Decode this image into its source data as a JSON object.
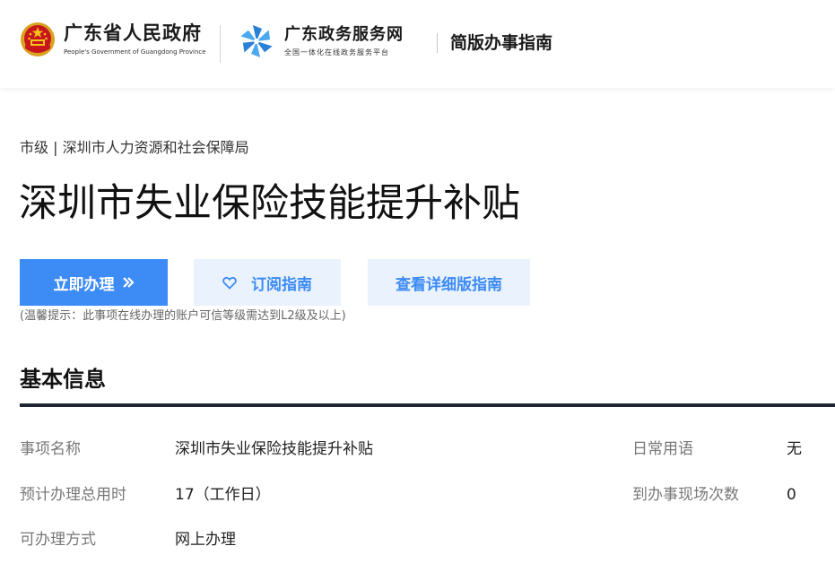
{
  "header": {
    "gov_name": "广东省人民政府",
    "gov_name_en": "People's Government of Guangdong Province",
    "service_name": "广东政务服务网",
    "service_subtitle": "全国一体化在线政务服务平台",
    "guide_title": "简版办事指南"
  },
  "breadcrumb": "市级 | 深圳市人力资源和社会保障局",
  "page_title": "深圳市失业保险技能提升补贴",
  "actions": {
    "apply_label": "立即办理",
    "apply_icon": "double-chevron-right-icon",
    "subscribe_label": "订阅指南",
    "subscribe_icon": "heart-icon",
    "detail_label": "查看详细版指南"
  },
  "tip": "(温馨提示：此事项在线办理的账户可信等级需达到L2级及以上)",
  "basic_info": {
    "title": "基本信息",
    "fields": [
      {
        "label": "事项名称",
        "value": "深圳市失业保险技能提升补贴"
      },
      {
        "label": "日常用语",
        "value": "无"
      },
      {
        "label": "预计办理总用时",
        "value": "17（工作日）"
      },
      {
        "label": "到办事现场次数",
        "value": "0"
      },
      {
        "label": "可办理方式",
        "value": "网上办理"
      }
    ]
  },
  "colors": {
    "primary": "#3d8bf5",
    "primary_light_bg": "#e9f2fd",
    "rule": "#1c2530",
    "label": "#777777"
  }
}
